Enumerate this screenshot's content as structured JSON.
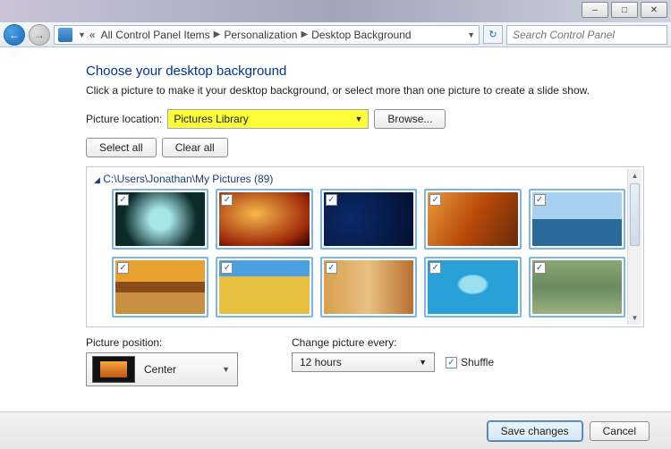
{
  "window": {
    "minimize": "–",
    "maximize": "□",
    "close": "✕"
  },
  "nav": {
    "back": "←",
    "fwd": "→",
    "crumb_prefix": "«",
    "crumbs": [
      "All Control Panel Items",
      "Personalization",
      "Desktop Background"
    ],
    "search_placeholder": "Search Control Panel",
    "refresh": "↻"
  },
  "page": {
    "title": "Choose your desktop background",
    "subtitle": "Click a picture to make it your desktop background, or select more than one picture to create a slide show.",
    "picture_location_label": "Picture location:",
    "picture_location_value": "Pictures Library",
    "browse": "Browse...",
    "select_all": "Select all",
    "clear_all": "Clear all"
  },
  "gallery": {
    "group_name": "C:\\Users\\Jonathan\\My Pictures (89)",
    "items": [
      {
        "checked": true
      },
      {
        "checked": true
      },
      {
        "checked": true
      },
      {
        "checked": true
      },
      {
        "checked": true
      },
      {
        "checked": true
      },
      {
        "checked": true
      },
      {
        "checked": true
      },
      {
        "checked": true
      },
      {
        "checked": true
      }
    ]
  },
  "options": {
    "position_label": "Picture position:",
    "position_value": "Center",
    "change_label": "Change picture every:",
    "change_value": "12 hours",
    "shuffle_label": "Shuffle",
    "shuffle_checked": true
  },
  "footer": {
    "save": "Save changes",
    "cancel": "Cancel"
  }
}
